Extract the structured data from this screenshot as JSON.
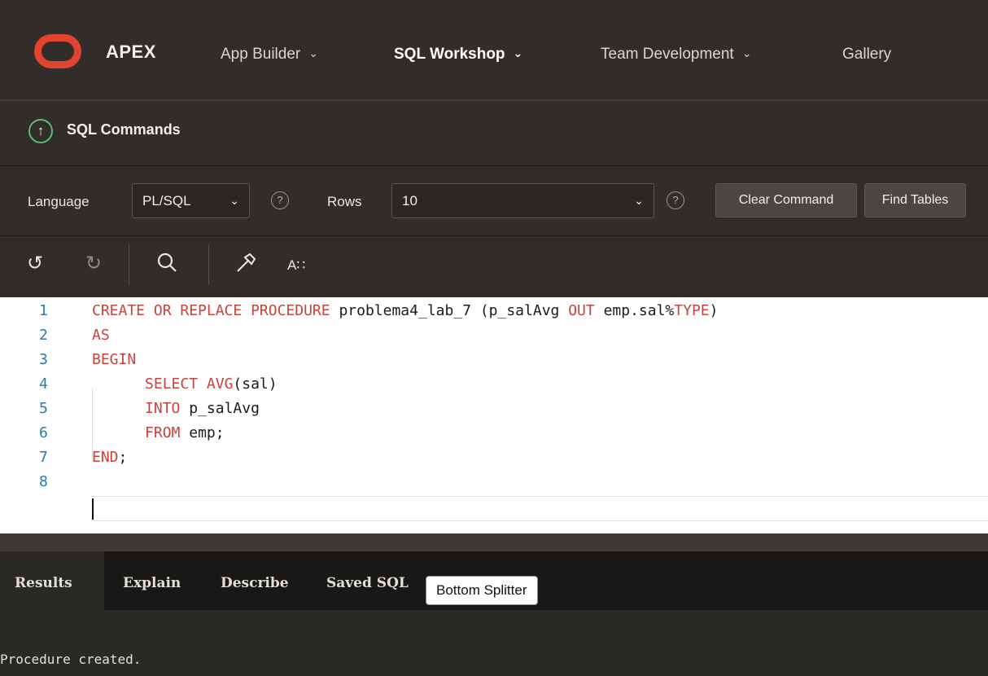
{
  "header": {
    "brand": "APEX",
    "nav": [
      {
        "label": "App Builder",
        "has_menu": true,
        "active": false
      },
      {
        "label": "SQL Workshop",
        "has_menu": true,
        "active": true
      },
      {
        "label": "Team Development",
        "has_menu": true,
        "active": false
      },
      {
        "label": "Gallery",
        "has_menu": false,
        "active": false
      }
    ]
  },
  "breadcrumb": {
    "icon": "arrow-up-circle-icon",
    "title": "SQL Commands"
  },
  "options": {
    "language_label": "Language",
    "language_value": "PL/SQL",
    "rows_label": "Rows",
    "rows_value": "10",
    "help_glyph": "?",
    "clear_command": "Clear Command",
    "find_tables": "Find Tables"
  },
  "toolbar": {
    "undo_icon": "undo-icon",
    "redo_icon": "redo-icon",
    "search_icon": "search-icon",
    "build_icon": "hammer-icon",
    "format_icon": "format-text-icon",
    "format_glyph": "A∷"
  },
  "editor": {
    "lines": [
      {
        "num": "1",
        "tokens": [
          {
            "t": "CREATE OR REPLACE PROCEDURE",
            "kw": true
          },
          {
            "t": " problema4_lab_7 (p_salAvg ",
            "kw": false
          },
          {
            "t": "OUT",
            "kw": true
          },
          {
            "t": " emp.sal%",
            "kw": false
          },
          {
            "t": "TYPE",
            "kw": true
          },
          {
            "t": ")",
            "kw": false
          }
        ]
      },
      {
        "num": "2",
        "tokens": [
          {
            "t": "AS",
            "kw": true
          }
        ]
      },
      {
        "num": "3",
        "tokens": [
          {
            "t": "BEGIN",
            "kw": true
          }
        ]
      },
      {
        "num": "4",
        "tokens": [
          {
            "t": "      ",
            "kw": false
          },
          {
            "t": "SELECT AVG",
            "kw": true
          },
          {
            "t": "(sal)",
            "kw": false
          }
        ]
      },
      {
        "num": "5",
        "tokens": [
          {
            "t": "      ",
            "kw": false
          },
          {
            "t": "INTO",
            "kw": true
          },
          {
            "t": " p_salAvg",
            "kw": false
          }
        ]
      },
      {
        "num": "6",
        "tokens": [
          {
            "t": "      ",
            "kw": false
          },
          {
            "t": "FROM",
            "kw": true
          },
          {
            "t": " emp;",
            "kw": false
          }
        ]
      },
      {
        "num": "7",
        "tokens": [
          {
            "t": "END",
            "kw": true
          },
          {
            "t": ";",
            "kw": false
          }
        ]
      },
      {
        "num": "8",
        "tokens": []
      }
    ]
  },
  "results": {
    "tabs": [
      "Results",
      "Explain",
      "Describe",
      "Saved SQL"
    ],
    "active_tab": "Results",
    "tooltip": "Bottom Splitter",
    "output": "Procedure created."
  },
  "colors": {
    "brand_red": "#e3432f",
    "keyword": "#c8433a",
    "line_number": "#2a7aa8",
    "header_bg": "#312d2a"
  }
}
